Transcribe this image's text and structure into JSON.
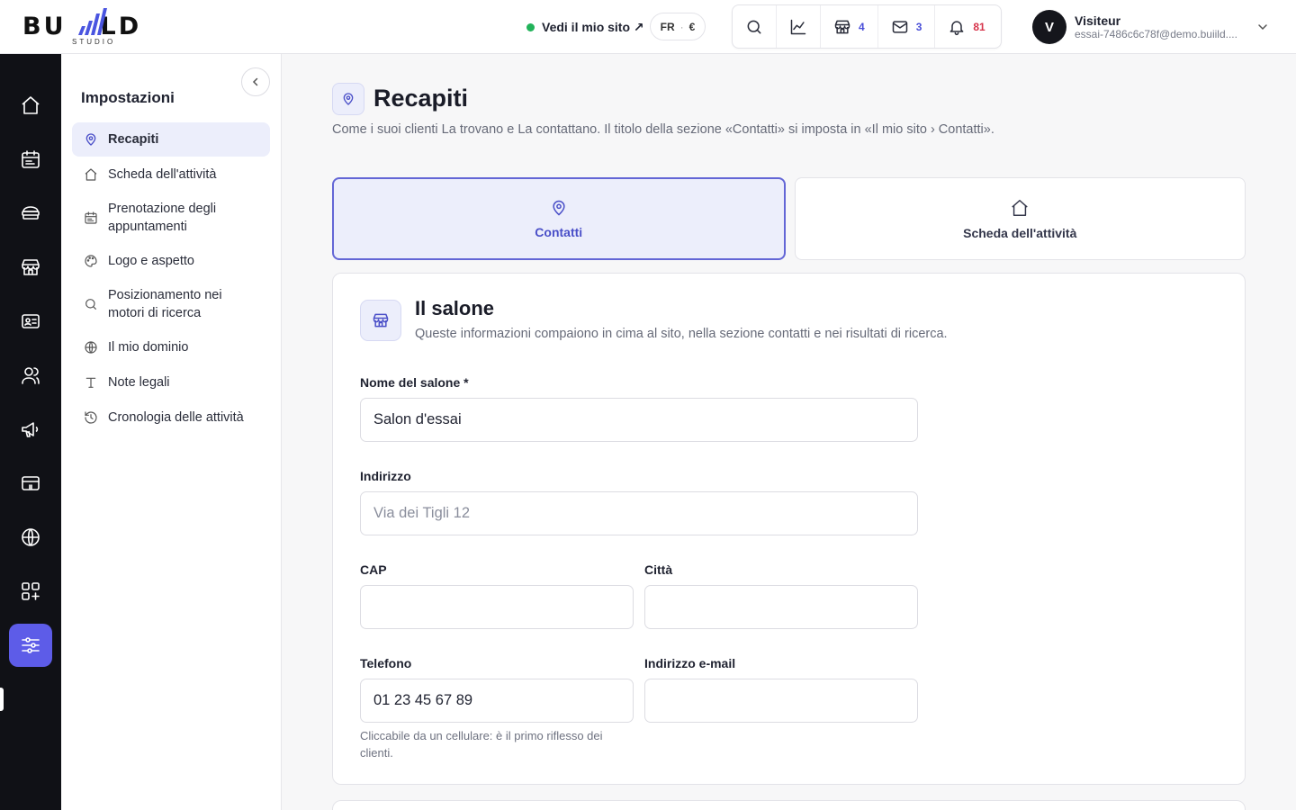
{
  "brand": {
    "logo_left": "BU",
    "logo_right": "LD",
    "logo_sub": "STUDIO"
  },
  "header": {
    "site_link": "Vedi il mio sito ↗",
    "lang": "FR",
    "currency": "€",
    "shop_count": "4",
    "mail_count": "3",
    "notif_count": "81"
  },
  "user": {
    "initial": "V",
    "name": "Visiteur",
    "email": "essai-7486c6c78f@demo.buiild...."
  },
  "sidebar": {
    "title": "Impostazioni",
    "items": [
      {
        "label": "Recapiti",
        "icon": "map-pin-icon"
      },
      {
        "label": "Scheda dell'attività",
        "icon": "home-icon"
      },
      {
        "label": "Prenotazione degli appuntamenti",
        "icon": "calendar-icon"
      },
      {
        "label": "Logo e aspetto",
        "icon": "palette-icon"
      },
      {
        "label": "Posizionamento nei motori di ricerca",
        "icon": "search-icon"
      },
      {
        "label": "Il mio dominio",
        "icon": "globe-icon"
      },
      {
        "label": "Note legali",
        "icon": "text-icon"
      },
      {
        "label": "Cronologia delle attività",
        "icon": "history-icon"
      }
    ]
  },
  "page": {
    "title": "Recapiti",
    "description": "Come i suoi clienti La trovano e La contattano. Il titolo della sezione «Contatti» si imposta in «Il mio sito › Contatti».",
    "tabs": [
      {
        "label": "Contatti"
      },
      {
        "label": "Scheda dell'attività"
      }
    ]
  },
  "section": {
    "title": "Il salone",
    "description": "Queste informazioni compaiono in cima al sito, nella sezione contatti e nei risultati di ricerca."
  },
  "form": {
    "name_label": "Nome del salone *",
    "name_value": "Salon d'essai",
    "address_label": "Indirizzo",
    "address_placeholder": "Via dei Tigli 12",
    "cap_label": "CAP",
    "city_label": "Città",
    "phone_label": "Telefono",
    "phone_value": "01 23 45 67 89",
    "phone_help": "Cliccabile da un cellulare: è il primo riflesso dei clienti.",
    "email_label": "Indirizzo e-mail"
  },
  "colors": {
    "accent": "#5d5ce8",
    "accent_soft": "#eceefb",
    "rail": "#101116",
    "online": "#22b35a",
    "alert": "#d6334a"
  }
}
